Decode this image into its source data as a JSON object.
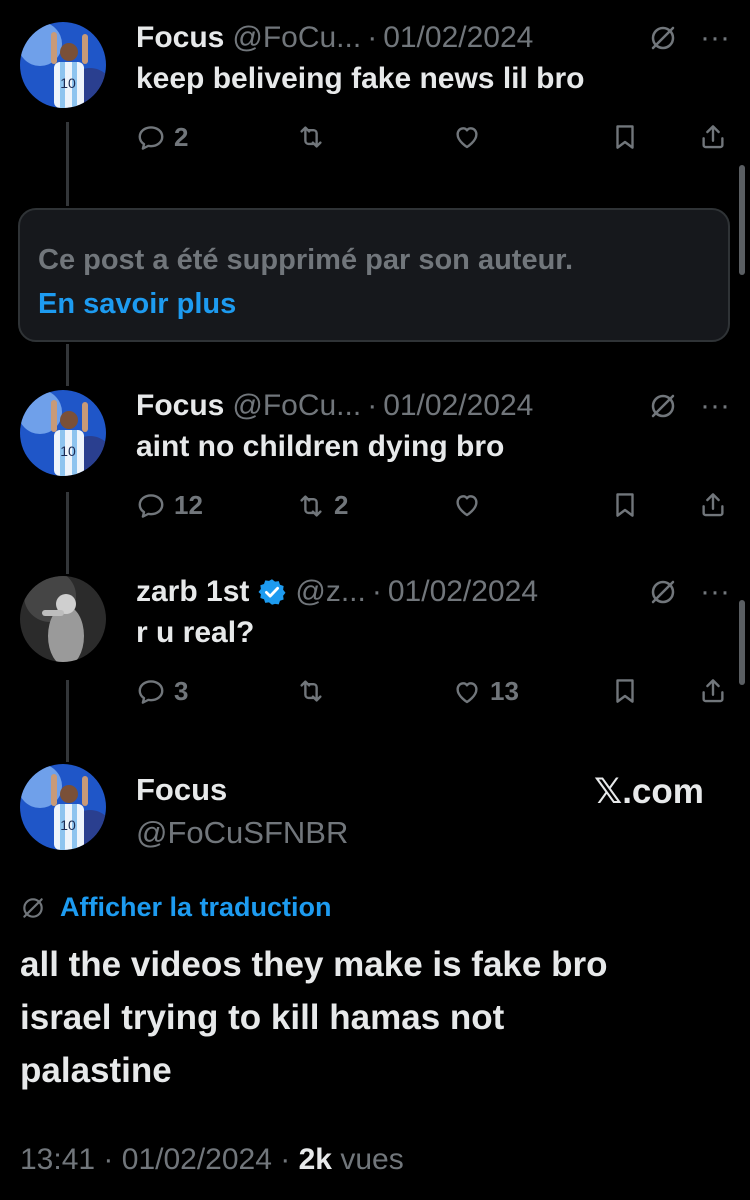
{
  "tweets": [
    {
      "name": "Focus",
      "handle": "@FoCu...",
      "sep": "·",
      "date": "01/02/2024",
      "text": "keep beliveing fake news lil bro",
      "replies": "2",
      "reposts": "",
      "likes": ""
    },
    {
      "name": "Focus",
      "handle": "@FoCu...",
      "sep": "·",
      "date": "01/02/2024",
      "text": "aint no children dying bro",
      "replies": "12",
      "reposts": "2",
      "likes": ""
    },
    {
      "name": "zarb 1st",
      "handle": "@z...",
      "sep": "·",
      "date": "01/02/2024",
      "text": "r u real?",
      "replies": "3",
      "reposts": "",
      "likes": "13",
      "verified": true
    }
  ],
  "deleted_notice": {
    "text": "Ce post a été supprimé par son auteur.",
    "link": "En savoir plus"
  },
  "more_glyph": "···",
  "main": {
    "name": "Focus",
    "handle": "@FoCuSFNBR",
    "brand": "𝕏.com",
    "translate": "Afficher la traduction",
    "text_lines": [
      "all the videos they make is fake bro",
      "israel trying to kill hamas not",
      "palastine"
    ],
    "time": "13:41",
    "date": "01/02/2024",
    "sep": "·",
    "views_count": "2k",
    "views_label": "vues"
  },
  "colors": {
    "background": "#000000",
    "text": "#e7e9ea",
    "secondary": "#71767b",
    "link": "#1d9bf0",
    "verified": "#1d9bf0"
  }
}
